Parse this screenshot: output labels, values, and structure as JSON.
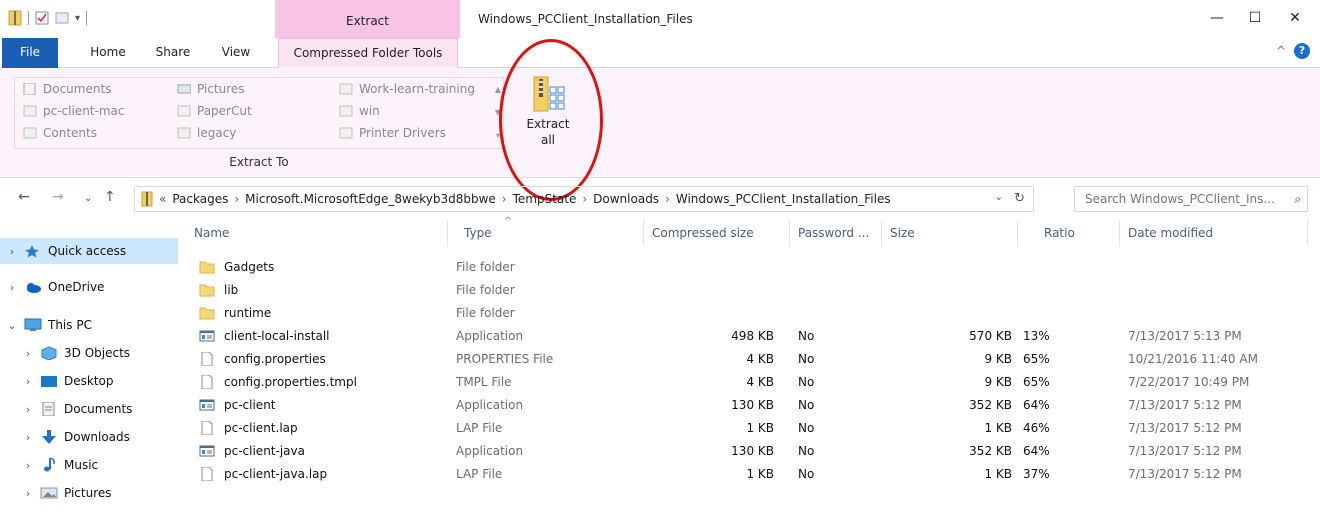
{
  "window": {
    "title": "Windows_PCClient_Installation_Files",
    "context_tab_header": "Extract",
    "controls": {
      "minimize": "—",
      "maximize": "☐",
      "close": "✕"
    }
  },
  "ribbon_tabs": [
    "File",
    "Home",
    "Share",
    "View",
    "Compressed Folder Tools"
  ],
  "ribbon": {
    "help": "?",
    "collapse": "^",
    "extract_to_items": [
      "Documents",
      "pc-client-mac",
      "Contents",
      "Pictures",
      "PaperCut",
      "legacy",
      "Work-learn-training",
      "win",
      "Printer Drivers"
    ],
    "extract_to_label": "Extract To",
    "extract_all_line1": "Extract",
    "extract_all_line2": "all"
  },
  "address": {
    "overflow": "«",
    "crumbs": [
      "Packages",
      "Microsoft.MicrosoftEdge_8wekyb3d8bbwe",
      "TempState",
      "Downloads",
      "Windows_PCClient_Installation_Files"
    ],
    "search_placeholder": "Search Windows_PCClient_Ins..."
  },
  "nav": {
    "items": [
      {
        "label": "Quick access",
        "expanded": false
      },
      {
        "label": "OneDrive",
        "expanded": false
      },
      {
        "label": "This PC",
        "expanded": true
      },
      {
        "label": "3D Objects",
        "expanded": false
      },
      {
        "label": "Desktop",
        "expanded": false
      },
      {
        "label": "Documents",
        "expanded": false
      },
      {
        "label": "Downloads",
        "expanded": false
      },
      {
        "label": "Music",
        "expanded": false
      },
      {
        "label": "Pictures",
        "expanded": false
      }
    ]
  },
  "columns": [
    "Name",
    "Type",
    "Compressed size",
    "Password ...",
    "Size",
    "Ratio",
    "Date modified"
  ],
  "files": [
    {
      "name": "Gadgets",
      "type": "File folder",
      "compressed": "",
      "password": "",
      "size": "",
      "ratio": "",
      "date": "",
      "kind": "folder"
    },
    {
      "name": "lib",
      "type": "File folder",
      "compressed": "",
      "password": "",
      "size": "",
      "ratio": "",
      "date": "",
      "kind": "folder"
    },
    {
      "name": "runtime",
      "type": "File folder",
      "compressed": "",
      "password": "",
      "size": "",
      "ratio": "",
      "date": "",
      "kind": "folder"
    },
    {
      "name": "client-local-install",
      "type": "Application",
      "compressed": "498 KB",
      "password": "No",
      "size": "570 KB",
      "ratio": "13%",
      "date": "7/13/2017 5:13 PM",
      "kind": "app"
    },
    {
      "name": "config.properties",
      "type": "PROPERTIES File",
      "compressed": "4 KB",
      "password": "No",
      "size": "9 KB",
      "ratio": "65%",
      "date": "10/21/2016 11:40 AM",
      "kind": "file"
    },
    {
      "name": "config.properties.tmpl",
      "type": "TMPL File",
      "compressed": "4 KB",
      "password": "No",
      "size": "9 KB",
      "ratio": "65%",
      "date": "7/22/2017 10:49 PM",
      "kind": "file"
    },
    {
      "name": "pc-client",
      "type": "Application",
      "compressed": "130 KB",
      "password": "No",
      "size": "352 KB",
      "ratio": "64%",
      "date": "7/13/2017 5:12 PM",
      "kind": "app"
    },
    {
      "name": "pc-client.lap",
      "type": "LAP File",
      "compressed": "1 KB",
      "password": "No",
      "size": "1 KB",
      "ratio": "46%",
      "date": "7/13/2017 5:12 PM",
      "kind": "file"
    },
    {
      "name": "pc-client-java",
      "type": "Application",
      "compressed": "130 KB",
      "password": "No",
      "size": "352 KB",
      "ratio": "64%",
      "date": "7/13/2017 5:12 PM",
      "kind": "app"
    },
    {
      "name": "pc-client-java.lap",
      "type": "LAP File",
      "compressed": "1 KB",
      "password": "No",
      "size": "1 KB",
      "ratio": "37%",
      "date": "7/13/2017 5:12 PM",
      "kind": "file"
    }
  ],
  "colors": {
    "accent": "#1a5fb4",
    "context_tab": "#f7c4e5",
    "ribbon_bg": "#fdf3fa",
    "selection": "#cce8ff",
    "highlight_circle": "#e01010",
    "folder": "#f8d775"
  }
}
